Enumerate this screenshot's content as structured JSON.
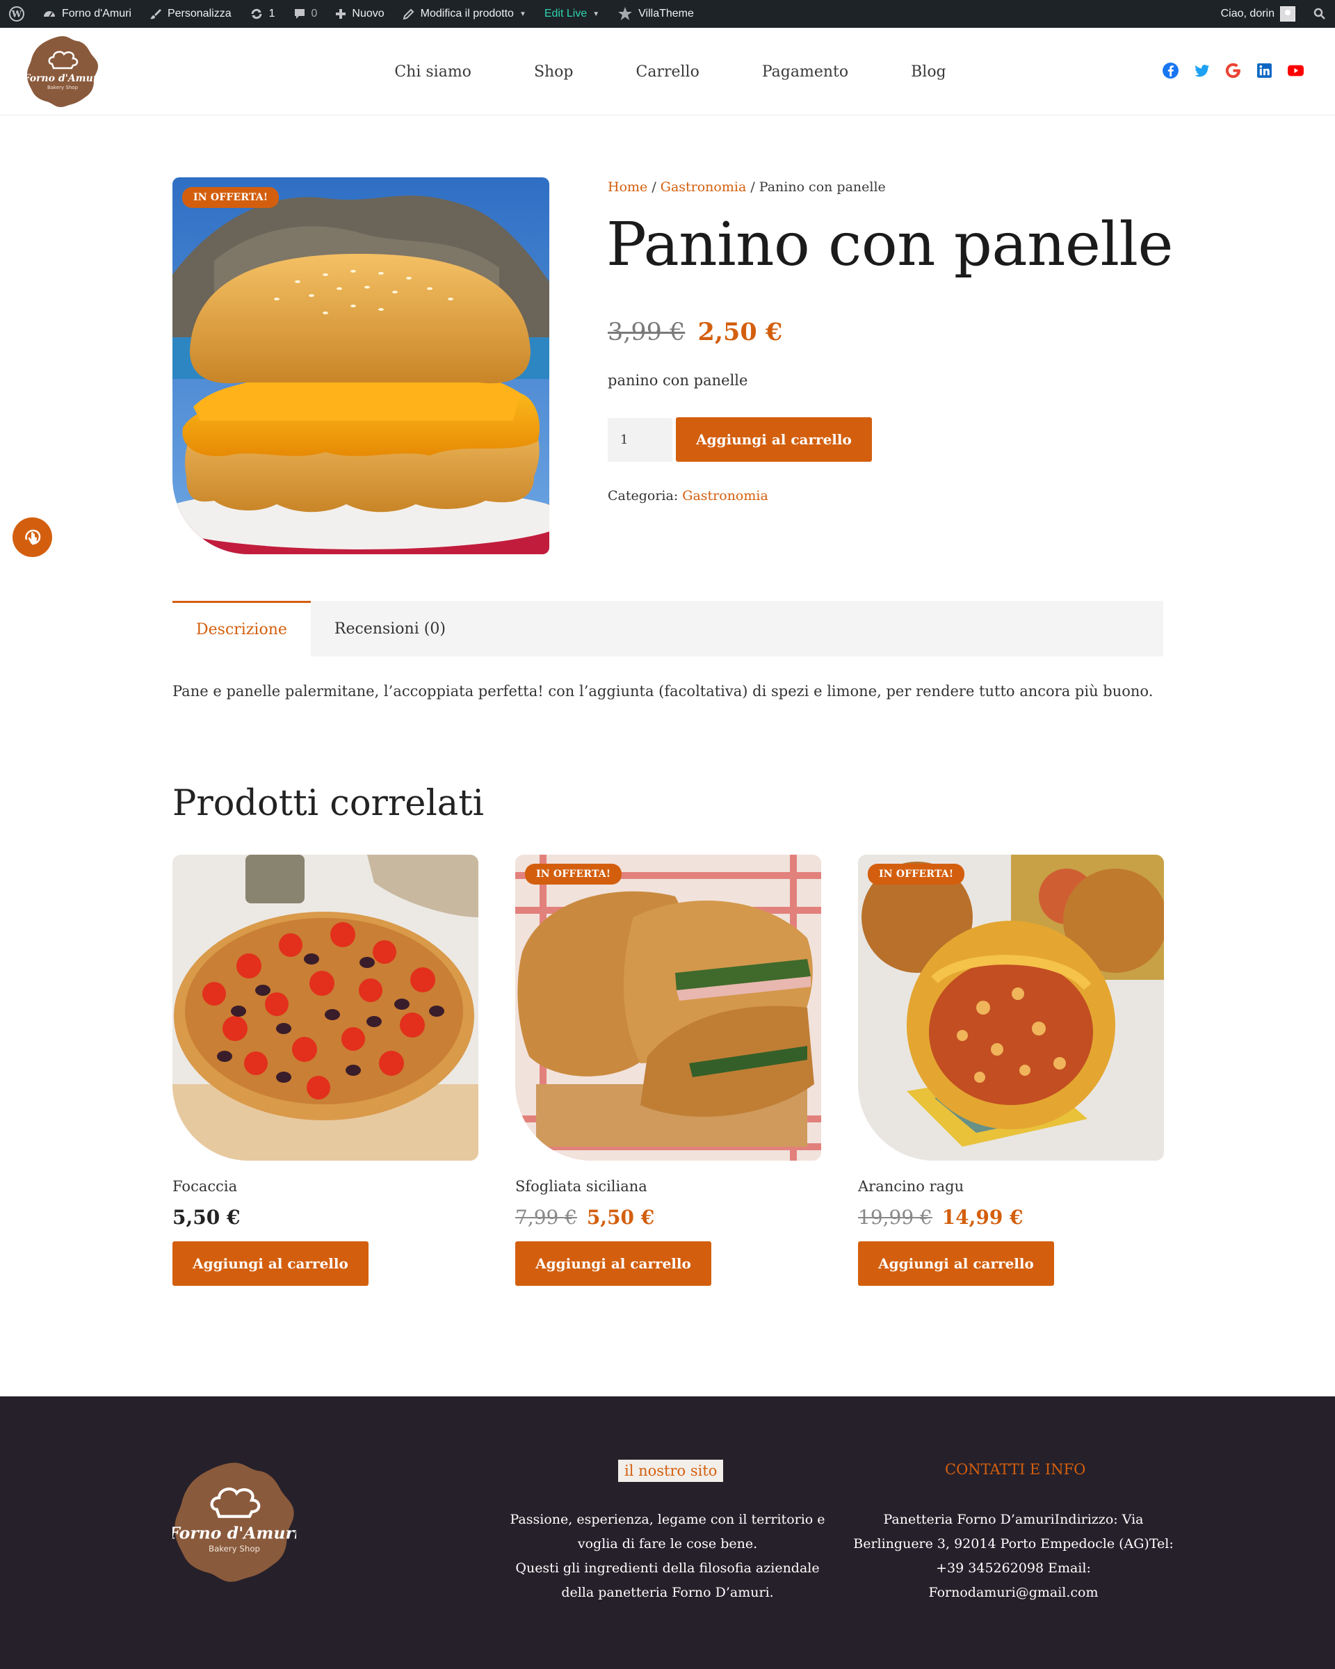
{
  "admin_bar": {
    "site_name": "Forno d'Amuri",
    "customize": "Personalizza",
    "updates_count": "1",
    "comments_count": "0",
    "new": "Nuovo",
    "edit_product": "Modifica il prodotto",
    "edit_live": "Edit Live",
    "villatheme": "VillaTheme",
    "greeting": "Ciao, dorin"
  },
  "header": {
    "logo_text": "Forno d'Amuri",
    "logo_subtext": "Bakery Shop",
    "nav": [
      "Chi siamo",
      "Shop",
      "Carrello",
      "Pagamento",
      "Blog"
    ],
    "social_icons": [
      "facebook-icon",
      "twitter-icon",
      "google-icon",
      "linkedin-icon",
      "youtube-icon"
    ]
  },
  "product": {
    "badge": "IN OFFERTA!",
    "breadcrumb": {
      "home": "Home",
      "sep1": " / ",
      "category": "Gastronomia",
      "sep2": " / ",
      "current": "Panino con panelle"
    },
    "title": "Panino con panelle",
    "old_price": "3,99 €",
    "price": "2,50 €",
    "short_description": "panino con panelle",
    "quantity": "1",
    "add_to_cart": "Aggiungi al carrello",
    "category_label": "Categoria: ",
    "category": "Gastronomia"
  },
  "tabs": [
    {
      "label": "Descrizione"
    },
    {
      "label": "Recensioni (0)"
    }
  ],
  "description": "Pane e panelle palermitane, l’accoppiata perfetta! con l’aggiunta (facoltativa) di spezi e limone, per rendere tutto ancora più buono.",
  "related": {
    "title": "Prodotti correlati",
    "items": [
      {
        "name": "Focaccia",
        "old_price": "",
        "price": "5,50 €",
        "badge": "",
        "button": "Aggiungi al carrello"
      },
      {
        "name": "Sfogliata siciliana",
        "old_price": "7,99 €",
        "price": "5,50 €",
        "badge": "IN OFFERTA!",
        "button": "Aggiungi al carrello"
      },
      {
        "name": "Arancino ragu",
        "old_price": "19,99 €",
        "price": "14,99 €",
        "badge": "IN OFFERTA!",
        "button": "Aggiungi al carrello"
      }
    ]
  },
  "footer": {
    "site_title": "il nostro sito",
    "site_text": [
      "Passione, esperienza, legame con il territorio e",
      "voglia di fare le cose bene.",
      "Questi gli ingredienti della filosofia aziendale",
      "della panetteria Forno D’amuri."
    ],
    "contact_title": "CONTATTI E INFO",
    "contact_text": [
      "Panetteria Forno D’amuriIndirizzo: Via",
      "Berlinguere 3, 92014 Porto Empedocle (AG)Tel:",
      "+39 345262098 Email:",
      "Fornodamuri@gmail.com"
    ]
  },
  "colors": {
    "accent": "#d35f0e",
    "admin_bar": "#1d2327",
    "footer": "#26202a",
    "logo_brown": "#8a5a3c"
  }
}
